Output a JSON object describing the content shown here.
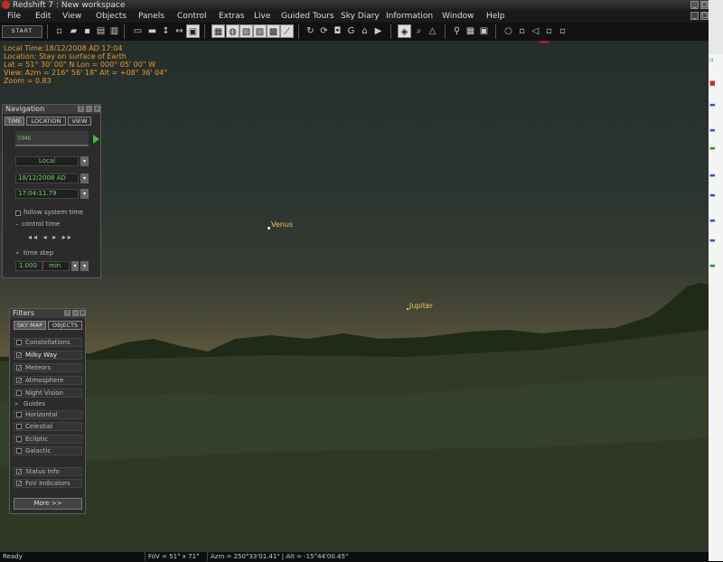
{
  "window": {
    "title": "Redshift 7 : New workspace"
  },
  "menu": [
    "File",
    "Edit",
    "View",
    "Objects",
    "Panels",
    "Control",
    "Extras",
    "Live",
    "Guided Tours",
    "Sky Diary",
    "Information",
    "Window",
    "Help"
  ],
  "toolbar": {
    "start_label": "START",
    "zoom_glyph": "G"
  },
  "info": {
    "local_time": "Local Time:18/12/2008 AD 17:04",
    "location": "Location: Stay on surface of Earth",
    "latlon": "Lat = 51° 30' 00\" N   Lon = 000° 05' 00\" W",
    "view": "View: Azm = 216° 56' 18\"   Alt = +08° 36' 04\"",
    "zoom": "Zoom = 0.83"
  },
  "sky": {
    "planets": [
      {
        "name": "Venus"
      },
      {
        "name": "Jupiter"
      }
    ]
  },
  "navigation": {
    "title": "Navigation",
    "tabs": [
      "TIME",
      "LOCATION",
      "VIEW"
    ],
    "time_header": "TIME",
    "mode": "Local",
    "date": "18/12/2008  AD",
    "time": "17:04:11.79",
    "follow_system": "follow system time",
    "control_time": "control time",
    "time_step": "time step",
    "step_value": "1.000",
    "step_unit": "min"
  },
  "filters": {
    "title": "Filters",
    "tabs": [
      "SKY MAP",
      "OBJECTS"
    ],
    "items": [
      {
        "label": "Constellations",
        "checked": false
      },
      {
        "label": "Milky Way",
        "checked": true
      },
      {
        "label": "Meteors",
        "checked": true
      },
      {
        "label": "Atmosphere",
        "checked": true
      },
      {
        "label": "Night Vision",
        "checked": false
      }
    ],
    "guides_label": "Guides",
    "guides": [
      {
        "label": "Horizontal",
        "checked": false
      },
      {
        "label": "Celestial",
        "checked": false
      },
      {
        "label": "Ecliptic",
        "checked": false
      },
      {
        "label": "Galactic",
        "checked": false
      }
    ],
    "extras": [
      {
        "label": "Status Info",
        "checked": true
      },
      {
        "label": "FoV Indicators",
        "checked": true
      }
    ],
    "more": "More >>"
  },
  "status": {
    "ready": "Ready",
    "fov": "FoV = 51° x 71°",
    "position": "Azm = 250°33'01.41\" | Alt = -15°44'00.45\""
  },
  "colors": {
    "overlay_text": "#f0952a",
    "planet_label": "#f4c25c",
    "field_text": "#6cd06c"
  }
}
